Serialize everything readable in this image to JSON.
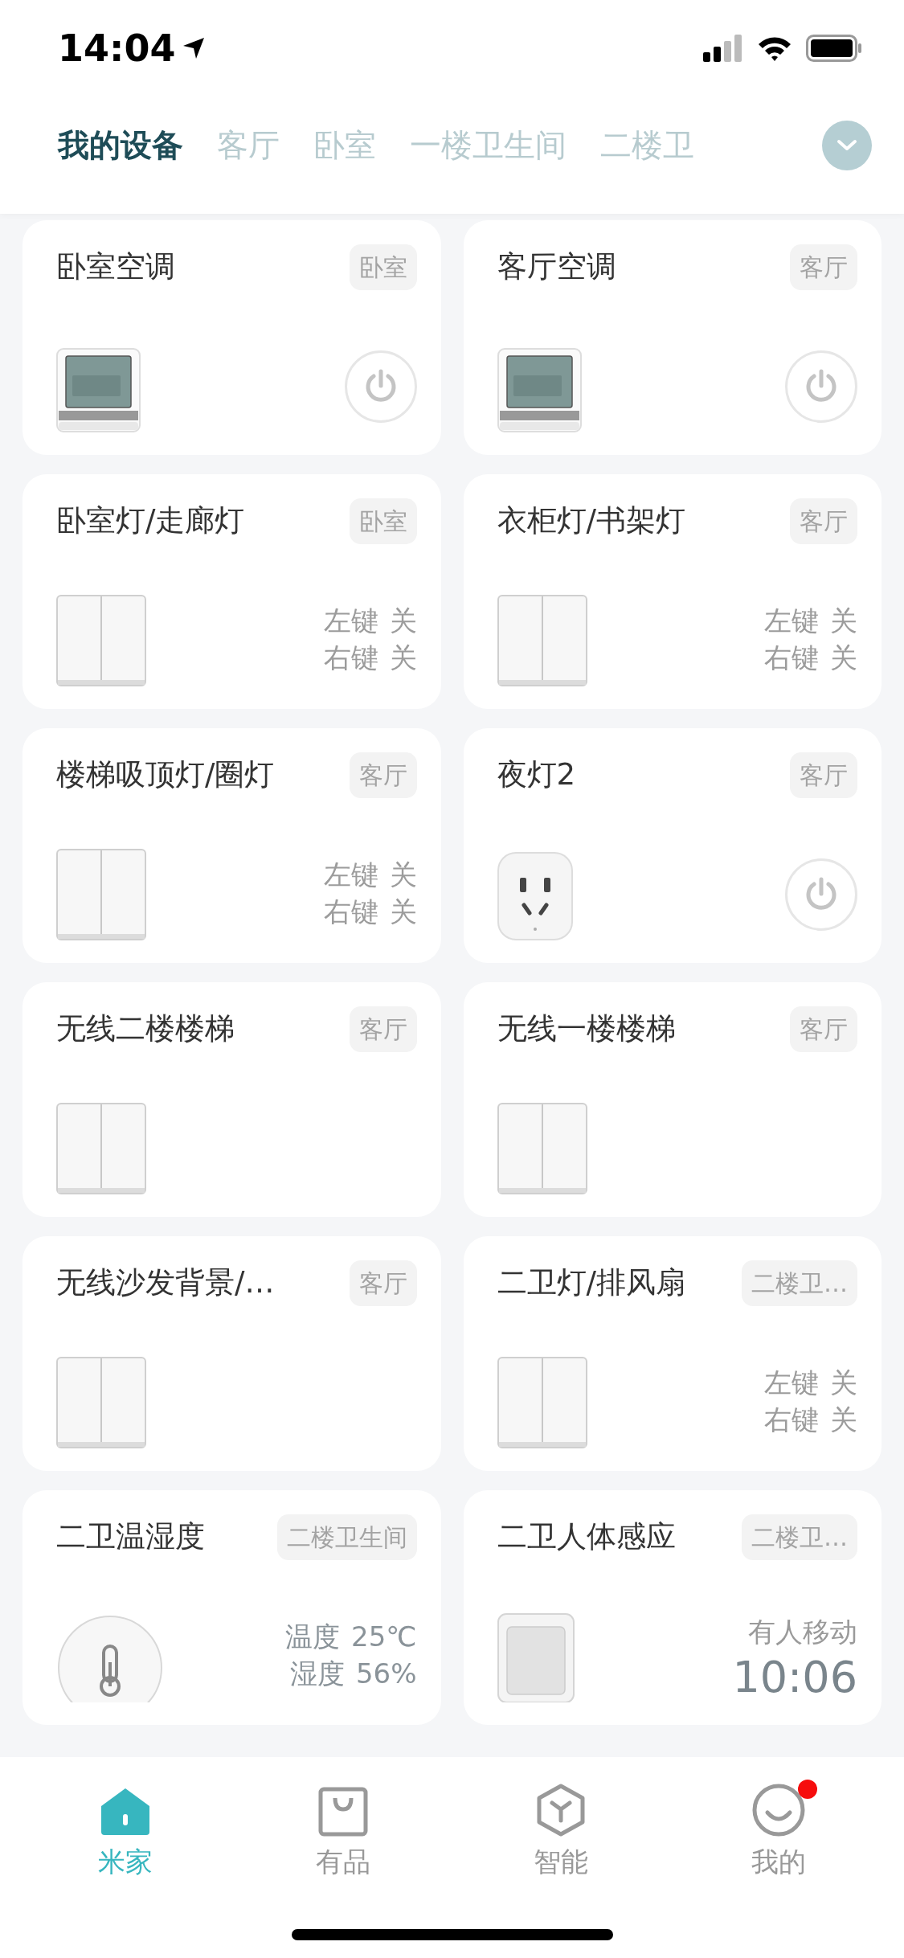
{
  "status_bar": {
    "time": "14:04"
  },
  "room_tabs": [
    {
      "label": "我的设备",
      "selected": true
    },
    {
      "label": "客厅",
      "selected": false
    },
    {
      "label": "卧室",
      "selected": false
    },
    {
      "label": "一楼卫生间",
      "selected": false
    },
    {
      "label": "二楼卫",
      "selected": false
    }
  ],
  "devices": [
    {
      "kind": "thermostat",
      "name": "卧室空调",
      "room": "卧室",
      "on": false
    },
    {
      "kind": "thermostat",
      "name": "客厅空调",
      "room": "客厅",
      "on": false
    },
    {
      "kind": "switch",
      "name": "卧室灯/走廊灯",
      "room": "卧室",
      "readings": [
        {
          "label": "左键",
          "value": "关"
        },
        {
          "label": "右键",
          "value": "关"
        }
      ]
    },
    {
      "kind": "switch",
      "name": "衣柜灯/书架灯",
      "room": "客厅",
      "readings": [
        {
          "label": "左键",
          "value": "关"
        },
        {
          "label": "右键",
          "value": "关"
        }
      ]
    },
    {
      "kind": "switch",
      "name": "楼梯吸顶灯/圈灯",
      "room": "客厅",
      "readings": [
        {
          "label": "左键",
          "value": "关"
        },
        {
          "label": "右键",
          "value": "关"
        }
      ]
    },
    {
      "kind": "plug",
      "name": "夜灯2",
      "room": "客厅",
      "on": false
    },
    {
      "kind": "switch",
      "name": "无线二楼楼梯",
      "room": "客厅"
    },
    {
      "kind": "switch",
      "name": "无线一楼楼梯",
      "room": "客厅"
    },
    {
      "kind": "switch",
      "name": "无线沙发背景/…",
      "room": "客厅"
    },
    {
      "kind": "switch",
      "name": "二卫灯/排风扇",
      "room": "二楼卫…",
      "readings": [
        {
          "label": "左键",
          "value": "关"
        },
        {
          "label": "右键",
          "value": "关"
        }
      ]
    },
    {
      "kind": "climate_sensor",
      "name": "二卫温湿度",
      "room": "二楼卫生间",
      "readings": [
        {
          "label": "温度",
          "value": "25℃"
        },
        {
          "label": "湿度",
          "value": "56%"
        }
      ]
    },
    {
      "kind": "motion_sensor",
      "name": "二卫人体感应",
      "room": "二楼卫…",
      "status": "有人移动",
      "time": "10:06"
    }
  ],
  "bottom_tabs": [
    {
      "kind": "home",
      "label": "米家",
      "selected": true,
      "badge": false
    },
    {
      "kind": "shop",
      "label": "有品",
      "selected": false,
      "badge": false
    },
    {
      "kind": "smart",
      "label": "智能",
      "selected": false,
      "badge": false
    },
    {
      "kind": "profile",
      "label": "我的",
      "selected": false,
      "badge": true
    }
  ]
}
